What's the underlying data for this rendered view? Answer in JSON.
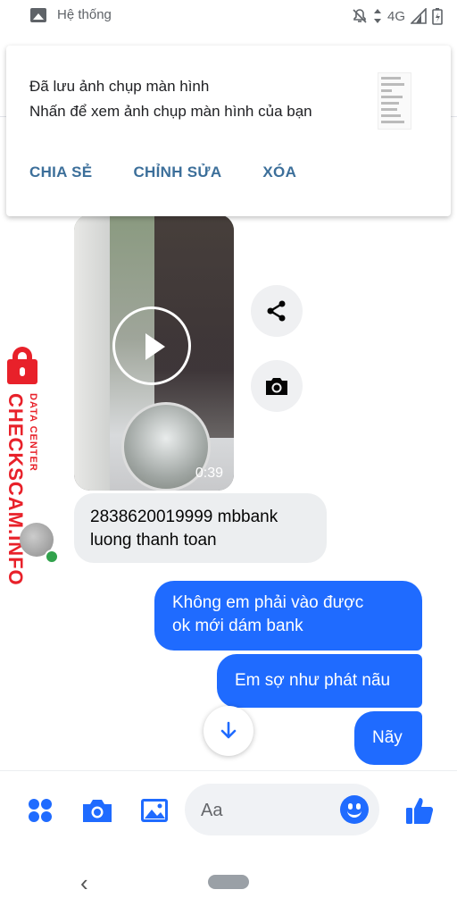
{
  "status_bar": {
    "title": "Hệ thống",
    "network": "4G",
    "icons": [
      "gallery-icon",
      "mute-icon",
      "data-arrows-icon",
      "signal-icon",
      "battery-icon"
    ]
  },
  "notification": {
    "title": "Đã lưu ảnh chụp màn hình",
    "body": "Nhấn để xem ảnh chụp màn hình của bạn",
    "actions": [
      "CHIA SẺ",
      "CHỈNH SỬA",
      "XÓA"
    ]
  },
  "watermark": {
    "brand": "CHECKSCAM.INFO",
    "sub": "DATA CENTER"
  },
  "messages": {
    "video": {
      "duration": "0:39"
    },
    "incoming_text": [
      "2838620019999 mbbank",
      "luong thanh toan"
    ],
    "outgoing": [
      [
        "Không em phải vào được",
        "ok mới dám bank"
      ],
      [
        "Em sợ như phát nãu"
      ],
      [
        "Nãy"
      ]
    ]
  },
  "composer": {
    "placeholder": "Aa",
    "icons": [
      "apps-icon",
      "camera-icon",
      "image-icon",
      "emoji-icon",
      "thumbs-up-icon"
    ]
  },
  "colors": {
    "accent": "#1f6bff",
    "bubble_in": "#eceef0",
    "watermark_red": "#e8212a",
    "notif_action": "#3c6f9a"
  }
}
